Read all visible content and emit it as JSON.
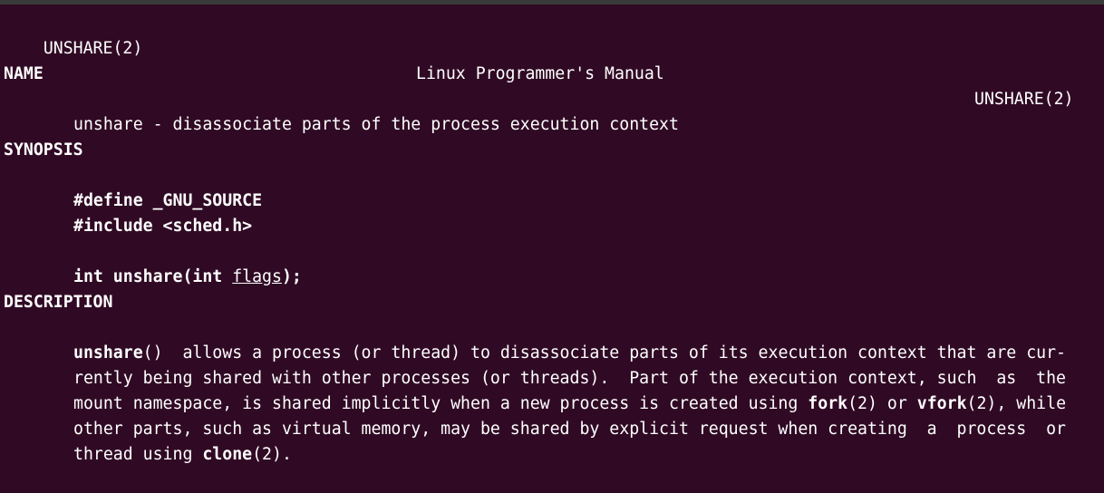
{
  "header": {
    "left": "UNSHARE(2)",
    "center": "Linux Programmer's Manual",
    "right": "UNSHARE(2)"
  },
  "name": {
    "heading": "NAME",
    "text": "unshare - disassociate parts of the process execution context"
  },
  "synopsis": {
    "heading": "SYNOPSIS",
    "define": "#define _GNU_SOURCE",
    "include": "#include <sched.h>",
    "proto_prefix": "int unshare(int ",
    "proto_arg": "flags",
    "proto_suffix": ");"
  },
  "description": {
    "heading": "DESCRIPTION",
    "l1_func": "unshare",
    "l1_rest": "()  allows a process (or thread) to disassociate parts of its execution context that are cur-",
    "l2": "rently being shared with other processes (or threads).  Part of the execution context, such  as  the",
    "l3_a": "mount namespace, is shared implicitly when a new process is created using ",
    "l3_fork": "fork",
    "l3_b": "(2) or ",
    "l3_vfork": "vfork",
    "l3_c": "(2), while",
    "l4": "other parts, such as virtual memory, may be shared by explicit request when creating  a  process  or",
    "l5_a": "thread using ",
    "l5_clone": "clone",
    "l5_b": "(2)."
  }
}
